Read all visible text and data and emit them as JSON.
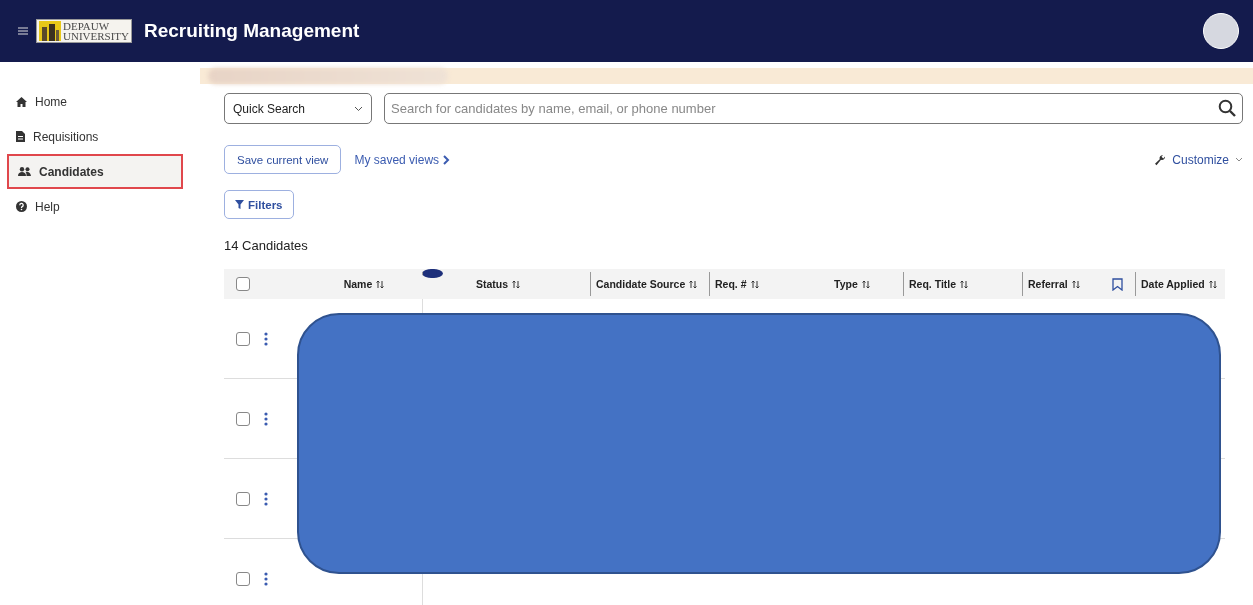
{
  "header": {
    "logo_lines": [
      "DEPAUW",
      "UNIVERSITY"
    ],
    "title": "Recruiting Management"
  },
  "sidebar": {
    "items": [
      {
        "label": "Home",
        "selected": false
      },
      {
        "label": "Requisitions",
        "selected": false
      },
      {
        "label": "Candidates",
        "selected": true
      },
      {
        "label": "Help",
        "selected": false
      }
    ]
  },
  "search": {
    "mode": "Quick Search",
    "placeholder": "Search for candidates by name, email, or phone number"
  },
  "view_actions": {
    "save": "Save current view",
    "saved_views": "My saved views",
    "customize": "Customize"
  },
  "filters": "Filters",
  "count": "14 Candidates",
  "table": {
    "columns": [
      {
        "kind": "checkbox",
        "checked": false
      },
      {
        "kind": "text",
        "label": "Name"
      },
      {
        "kind": "dot"
      },
      {
        "kind": "text",
        "label": "Status"
      },
      {
        "kind": "text",
        "label": "Candidate Source"
      },
      {
        "kind": "text",
        "label": "Req. #"
      },
      {
        "kind": "text",
        "label": "Type"
      },
      {
        "kind": "text",
        "label": "Req. Title"
      },
      {
        "kind": "text",
        "label": "Referral"
      },
      {
        "kind": "bookmark"
      },
      {
        "kind": "text",
        "label": "Date Applied"
      }
    ],
    "rows": [
      {
        "checked": false
      },
      {
        "checked": false
      },
      {
        "checked": false
      },
      {
        "checked": false
      }
    ]
  }
}
